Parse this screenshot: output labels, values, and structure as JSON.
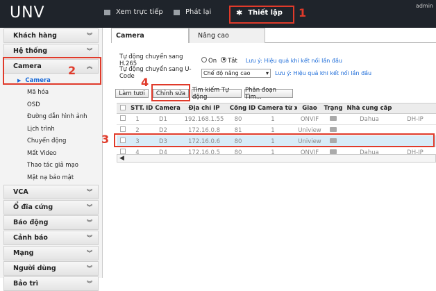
{
  "topbar": {
    "logo": "UNV",
    "nav_live": "Xem trực tiếp",
    "nav_playback": "Phát lại",
    "nav_setup": "Thiết lập",
    "user": "admin"
  },
  "annotations": {
    "n1": "1",
    "n2": "2",
    "n3": "3",
    "n4": "4"
  },
  "sidebar": {
    "customer": "Khách hàng",
    "system": "Hệ thống",
    "camera": "Camera",
    "camera_items": [
      "Camera",
      "Mã hóa",
      "OSD",
      "Đường dẫn hình ảnh",
      "Lịch trình",
      "Chuyển động",
      "Mất Video",
      "Thao tác giả mạo",
      "Mặt nạ bảo mật"
    ],
    "vca": "VCA",
    "disk": "Ổ đĩa cứng",
    "alarm": "Báo động",
    "warning": "Cảnh báo",
    "network": "Mạng",
    "users": "Người dùng",
    "maintenance": "Bảo trì"
  },
  "tabs": {
    "camera": "Camera",
    "advanced": "Nâng cao"
  },
  "settings": {
    "h265_label": "Tự động chuyển sang H.265",
    "on": "On",
    "off": "Tắt",
    "h265_hint": "Lưu ý: Hiệu quả khi kết nối lần đầu",
    "ucode_label": "Tự động chuyển sang U-Code",
    "ucode_value": "Chế độ nâng cao",
    "ucode_hint": "Lưu ý: Hiệu quả khi kết nối lần đầu"
  },
  "buttons": {
    "refresh": "Làm tươi",
    "edit": "Chỉnh sửa",
    "auto_search": "Tìm kiếm Tự động",
    "segment_search": "Phân đoạn Tìm..."
  },
  "table": {
    "headers": [
      "STT.",
      "ID Camera",
      "Địa chỉ IP",
      "Cổng",
      "ID Camera từ xa",
      "Giao",
      "Trạng",
      "Nhà cung cấp",
      ""
    ],
    "rows": [
      [
        "1",
        "D1",
        "192.168.1.55",
        "80",
        "1",
        "ONVIF",
        "",
        "Dahua",
        "DH-IP"
      ],
      [
        "2",
        "D2",
        "172.16.0.8",
        "81",
        "1",
        "Uniview",
        "",
        "",
        ""
      ],
      [
        "3",
        "D3",
        "172.16.0.6",
        "80",
        "1",
        "Uniview",
        "",
        "",
        ""
      ],
      [
        "4",
        "D4",
        "172.16.0.5",
        "80",
        "1",
        "ONVIF",
        "",
        "Dahua",
        "DH-IP"
      ]
    ]
  },
  "colors": {
    "accent": "#e03a2a",
    "link": "#1a6ad8",
    "topbar": "#1f242b"
  }
}
